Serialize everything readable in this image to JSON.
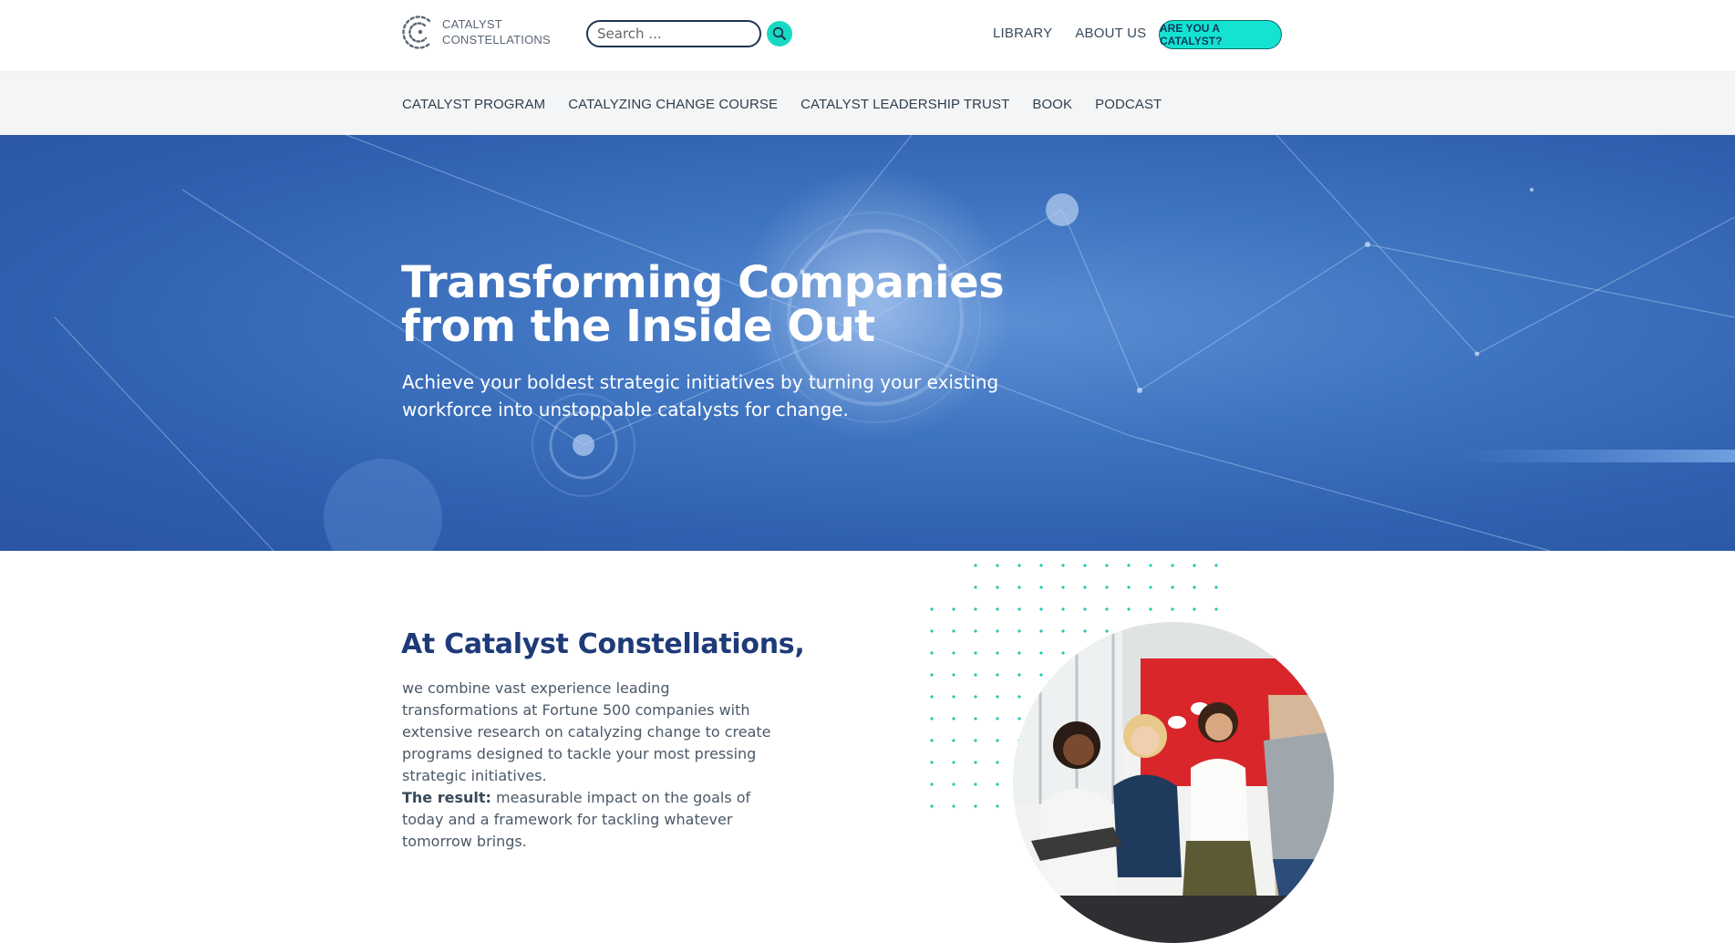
{
  "header": {
    "logo_line1": "CATALYST",
    "logo_line2": "CONSTELLATIONS",
    "search_placeholder": "Search ...",
    "links": [
      "LIBRARY",
      "ABOUT US"
    ],
    "cta_label": "ARE YOU A CATALYST?"
  },
  "subnav": {
    "items": [
      "CATALYST PROGRAM",
      "CATALYZING CHANGE COURSE",
      "CATALYST LEADERSHIP TRUST",
      "BOOK",
      "PODCAST"
    ]
  },
  "hero": {
    "title_line1": "Transforming Companies",
    "title_line2": "from the Inside Out",
    "subtitle": "Achieve your boldest strategic initiatives by turning your existing workforce into unstoppable catalysts for change."
  },
  "intro": {
    "heading": "At Catalyst Constellations,",
    "paragraph": "we combine vast experience leading transformations at Fortune 500 companies with extensive research on catalyzing change to create programs designed to tackle your most pressing strategic initiatives.",
    "result_label": "The result:",
    "result_text": " measurable impact on the goals of today and a framework for tackling whatever tomorrow brings."
  },
  "colors": {
    "accent": "#15e3d2",
    "heading_blue": "#1e3a78",
    "hero_blue": "#3f74c0"
  },
  "icons": {
    "logo": "catalyst-logo-icon",
    "search": "search-icon"
  }
}
